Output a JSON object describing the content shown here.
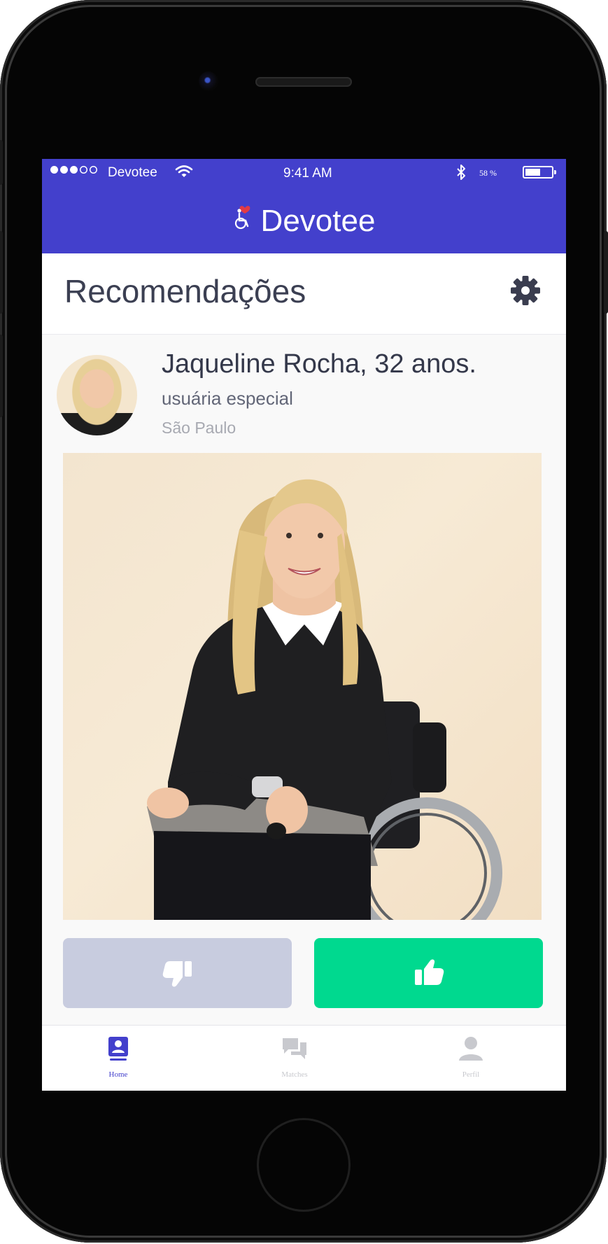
{
  "status_bar": {
    "carrier": "Devotee",
    "time": "9:41 AM",
    "battery_text": "58 %",
    "battery_level": 0.58,
    "signal_bars": 3,
    "signal_total": 5
  },
  "header": {
    "brand": "Devotee",
    "logo_icon": "wheelchair-heart-icon"
  },
  "page": {
    "title": "Recomendações",
    "settings_icon": "gear-icon"
  },
  "profile": {
    "name": "Jaqueline Rocha, 32 anos.",
    "tag": "usuária especial",
    "city": "São Paulo"
  },
  "actions": {
    "dislike_icon": "thumbs-down-icon",
    "like_icon": "thumbs-up-icon"
  },
  "tabbar": {
    "items": [
      {
        "label": "Home",
        "icon": "profile-card-icon",
        "active": true
      },
      {
        "label": "Matches",
        "icon": "chat-bubbles-icon",
        "active": false
      },
      {
        "label": "Perfil",
        "icon": "user-icon",
        "active": false
      }
    ]
  },
  "colors": {
    "primary": "#4340cc",
    "like": "#00d98f",
    "dislike": "#c8ccdf",
    "title_text": "#3b3f52",
    "inactive_tab": "#c8c9ce"
  }
}
